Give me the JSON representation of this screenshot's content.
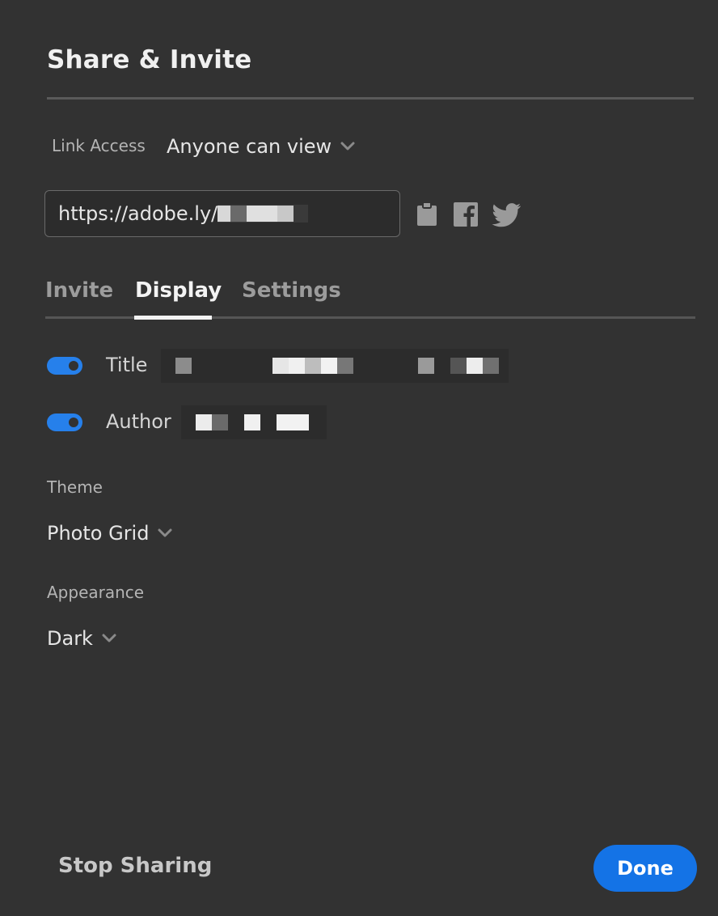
{
  "dialog": {
    "title": "Share & Invite"
  },
  "link_access": {
    "label": "Link Access",
    "value": "Anyone can view"
  },
  "share_url": {
    "prefix": "https://adobe.ly/"
  },
  "share_icons": [
    "clipboard-icon",
    "facebook-icon",
    "twitter-icon"
  ],
  "tabs": [
    {
      "label": "Invite",
      "active": false
    },
    {
      "label": "Display",
      "active": true
    },
    {
      "label": "Settings",
      "active": false
    }
  ],
  "display": {
    "title_toggle": {
      "label": "Title",
      "on": true
    },
    "author_toggle": {
      "label": "Author",
      "on": true
    },
    "theme": {
      "label": "Theme",
      "value": "Photo Grid"
    },
    "appearance": {
      "label": "Appearance",
      "value": "Dark"
    }
  },
  "footer": {
    "stop_sharing": "Stop Sharing",
    "done": "Done"
  },
  "colors": {
    "background": "#323232",
    "accent": "#1473e6",
    "toggle_on": "#2680eb"
  }
}
